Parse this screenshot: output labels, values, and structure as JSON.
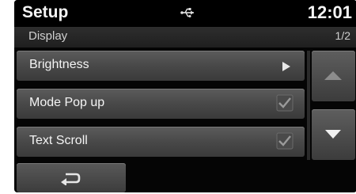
{
  "header": {
    "title": "Setup",
    "time": "12:01",
    "status_icon": "usb-icon"
  },
  "subheader": {
    "section": "Display",
    "page": "1/2"
  },
  "menu": {
    "items": [
      {
        "label": "Brightness",
        "control": "chevron-right-icon"
      },
      {
        "label": "Mode Pop up",
        "control": "checkmark-icon",
        "checked": true
      },
      {
        "label": "Text Scroll",
        "control": "checkmark-icon",
        "checked": true
      }
    ]
  },
  "scroll": {
    "up_icon": "arrow-up-icon",
    "down_icon": "arrow-down-icon",
    "up_enabled": false,
    "down_enabled": true
  },
  "footer": {
    "back_icon": "back-arrow-icon"
  },
  "colors": {
    "background": "#050505",
    "item_top": "#5c5c5c",
    "item_bottom": "#3a3a3a",
    "text": "#f2f2f2"
  }
}
